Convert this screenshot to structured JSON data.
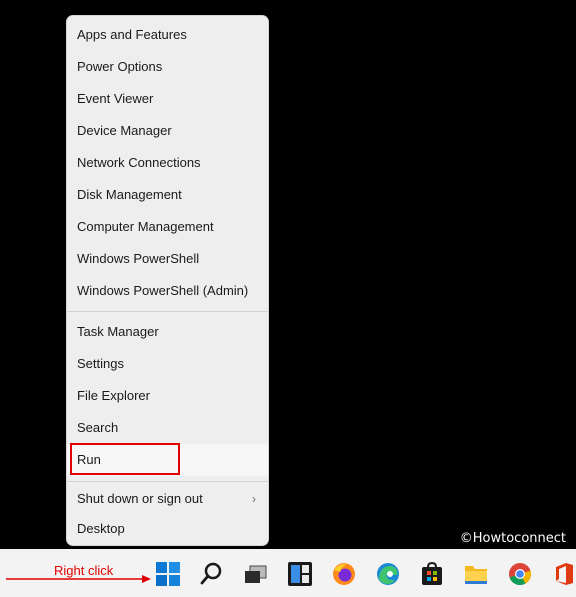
{
  "context_menu": {
    "group1": [
      "Apps and Features",
      "Power Options",
      "Event Viewer",
      "Device Manager",
      "Network Connections",
      "Disk Management",
      "Computer Management",
      "Windows PowerShell",
      "Windows PowerShell (Admin)"
    ],
    "group2": [
      "Task Manager",
      "Settings",
      "File Explorer",
      "Search",
      "Run"
    ],
    "group3": [
      "Shut down or sign out",
      "Desktop"
    ],
    "highlighted_item": "Run",
    "submenu_indicator": "›"
  },
  "annotation": {
    "label": "Right click",
    "color": "#e00000"
  },
  "watermark": "©Howtoconnect",
  "taskbar": {
    "icons": [
      "windows-start-icon",
      "search-icon",
      "task-view-icon",
      "widgets-icon",
      "firefox-icon",
      "edge-icon",
      "microsoft-store-icon",
      "file-explorer-icon",
      "chrome-icon",
      "office-icon"
    ]
  }
}
